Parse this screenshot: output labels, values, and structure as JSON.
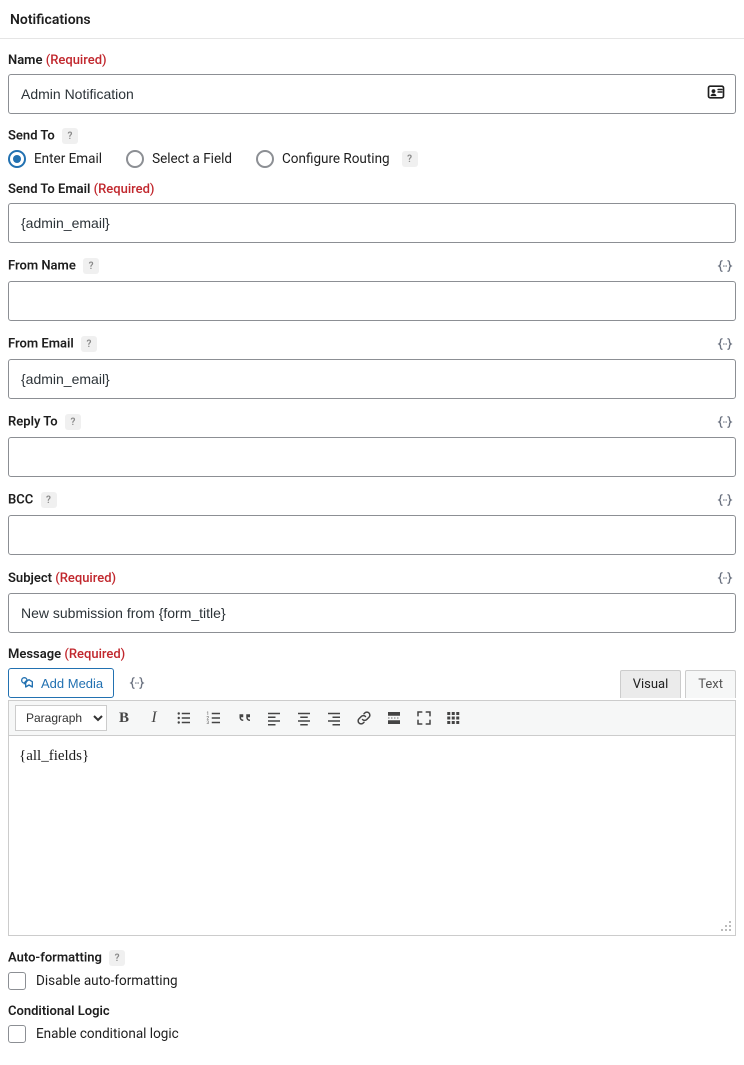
{
  "page": {
    "title": "Notifications"
  },
  "required_text": "(Required)",
  "name": {
    "label": "Name",
    "value": "Admin Notification"
  },
  "send_to": {
    "label": "Send To",
    "options": {
      "enter_email": "Enter Email",
      "select_field": "Select a Field",
      "configure_routing": "Configure Routing"
    }
  },
  "send_to_email": {
    "label": "Send To Email",
    "value": "{admin_email}"
  },
  "from_name": {
    "label": "From Name",
    "value": ""
  },
  "from_email": {
    "label": "From Email",
    "value": "{admin_email}"
  },
  "reply_to": {
    "label": "Reply To",
    "value": ""
  },
  "bcc": {
    "label": "BCC",
    "value": ""
  },
  "subject": {
    "label": "Subject",
    "value": "New submission from {form_title}"
  },
  "message": {
    "label": "Message",
    "add_media": "Add Media",
    "tab_visual": "Visual",
    "tab_text": "Text",
    "paragraph_option": "Paragraph",
    "content": "{all_fields}"
  },
  "auto_formatting": {
    "label": "Auto-formatting",
    "checkbox_label": "Disable auto-formatting"
  },
  "conditional_logic": {
    "label": "Conditional Logic",
    "checkbox_label": "Enable conditional logic"
  }
}
